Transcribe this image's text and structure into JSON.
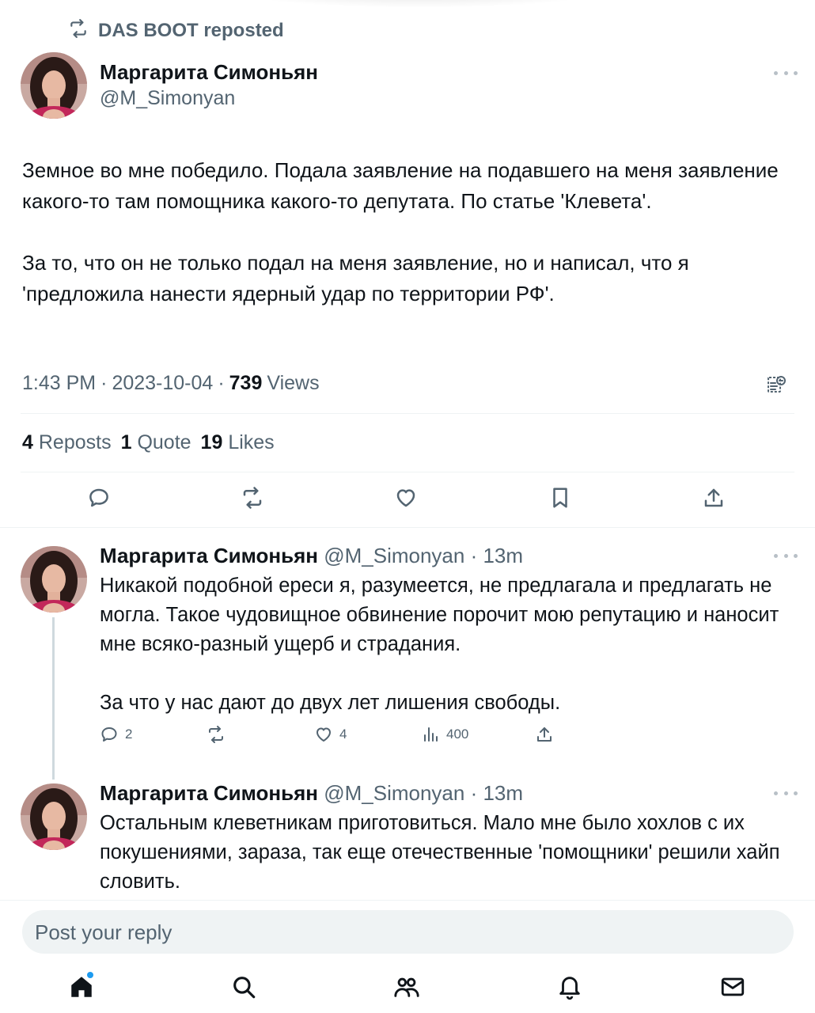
{
  "repost": {
    "text": "DAS BOOT reposted",
    "icon": "repost-icon"
  },
  "main_tweet": {
    "name": "Маргарита Симоньян",
    "handle": "@M_Simonyan",
    "paragraphs": [
      "Земное во мне победило. Подала заявление на подавшего на меня заявление какого-то там помощника какого-то депутата. По статье 'Клевета'.",
      "За то, что он не только подал на меня заявление, но и написал, что я 'предложила нанести ядерный удар по территории РФ'."
    ],
    "time": "1:43 PM",
    "date": "2023-10-04",
    "sep": "·",
    "views_count": "739",
    "views_label": "Views",
    "stats": {
      "reposts_count": "4",
      "reposts_label": "Reposts",
      "quotes_count": "1",
      "quotes_label": "Quote",
      "likes_count": "19",
      "likes_label": "Likes"
    },
    "actions": [
      "reply-icon",
      "repost-icon",
      "like-icon",
      "bookmark-icon",
      "share-icon"
    ]
  },
  "replies": [
    {
      "name": "Маргарита Симоньян",
      "handle_time": "@M_Simonyan · 13m",
      "paragraphs": [
        "Никакой подобной ереси я, разумеется, не предлагала и предлагать не могла. Такое чудовищное обвинение порочит мою репутацию и наносит мне всяко-разный ущерб и страдания.",
        "За что у нас дают до двух лет лишения свободы."
      ],
      "reply_count": "2",
      "repost_count": "",
      "like_count": "4",
      "view_count": "400"
    },
    {
      "name": "Маргарита Симоньян",
      "handle_time": "@M_Simonyan · 13m",
      "paragraphs": [
        "Остальным клеветникам приготовиться. Мало мне было хохлов с их покушениями, зараза, так еще отечественные 'помощники' решили хайп словить."
      ]
    }
  ],
  "reply_box": {
    "placeholder": "Post your reply"
  },
  "bottom_nav": [
    "home-icon",
    "search-icon",
    "communities-icon",
    "notifications-icon",
    "messages-icon"
  ],
  "colors": {
    "text": "#0f1419",
    "secondary": "#536471",
    "accent": "#1d9bf0",
    "divider": "#eff3f4",
    "thread_line": "#cfd9de"
  }
}
